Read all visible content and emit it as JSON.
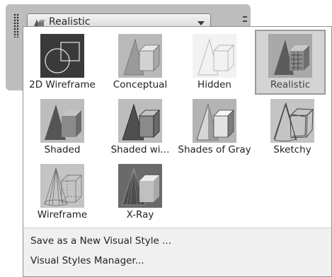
{
  "toolbar": {
    "dropdown": {
      "selected": "Realistic",
      "icon": "visual-style-icon"
    }
  },
  "styles": [
    {
      "label": "2D Wireframe",
      "icon": "2d-wireframe-thumbnail",
      "selected": false
    },
    {
      "label": "Conceptual",
      "icon": "conceptual-thumbnail",
      "selected": false
    },
    {
      "label": "Hidden",
      "icon": "hidden-thumbnail",
      "selected": false
    },
    {
      "label": "Realistic",
      "icon": "realistic-thumbnail",
      "selected": true
    },
    {
      "label": "Shaded",
      "icon": "shaded-thumbnail",
      "selected": false
    },
    {
      "label": "Shaded wi...",
      "icon": "shaded-with-edges-thumbnail",
      "selected": false
    },
    {
      "label": "Shades of Gray",
      "icon": "shades-of-gray-thumbnail",
      "selected": false
    },
    {
      "label": "Sketchy",
      "icon": "sketchy-thumbnail",
      "selected": false
    },
    {
      "label": "Wireframe",
      "icon": "wireframe-thumbnail",
      "selected": false
    },
    {
      "label": "X-Ray",
      "icon": "x-ray-thumbnail",
      "selected": false
    }
  ],
  "menu": {
    "save_label": "Save as a New Visual Style ...",
    "manager_label": "Visual Styles Manager..."
  }
}
